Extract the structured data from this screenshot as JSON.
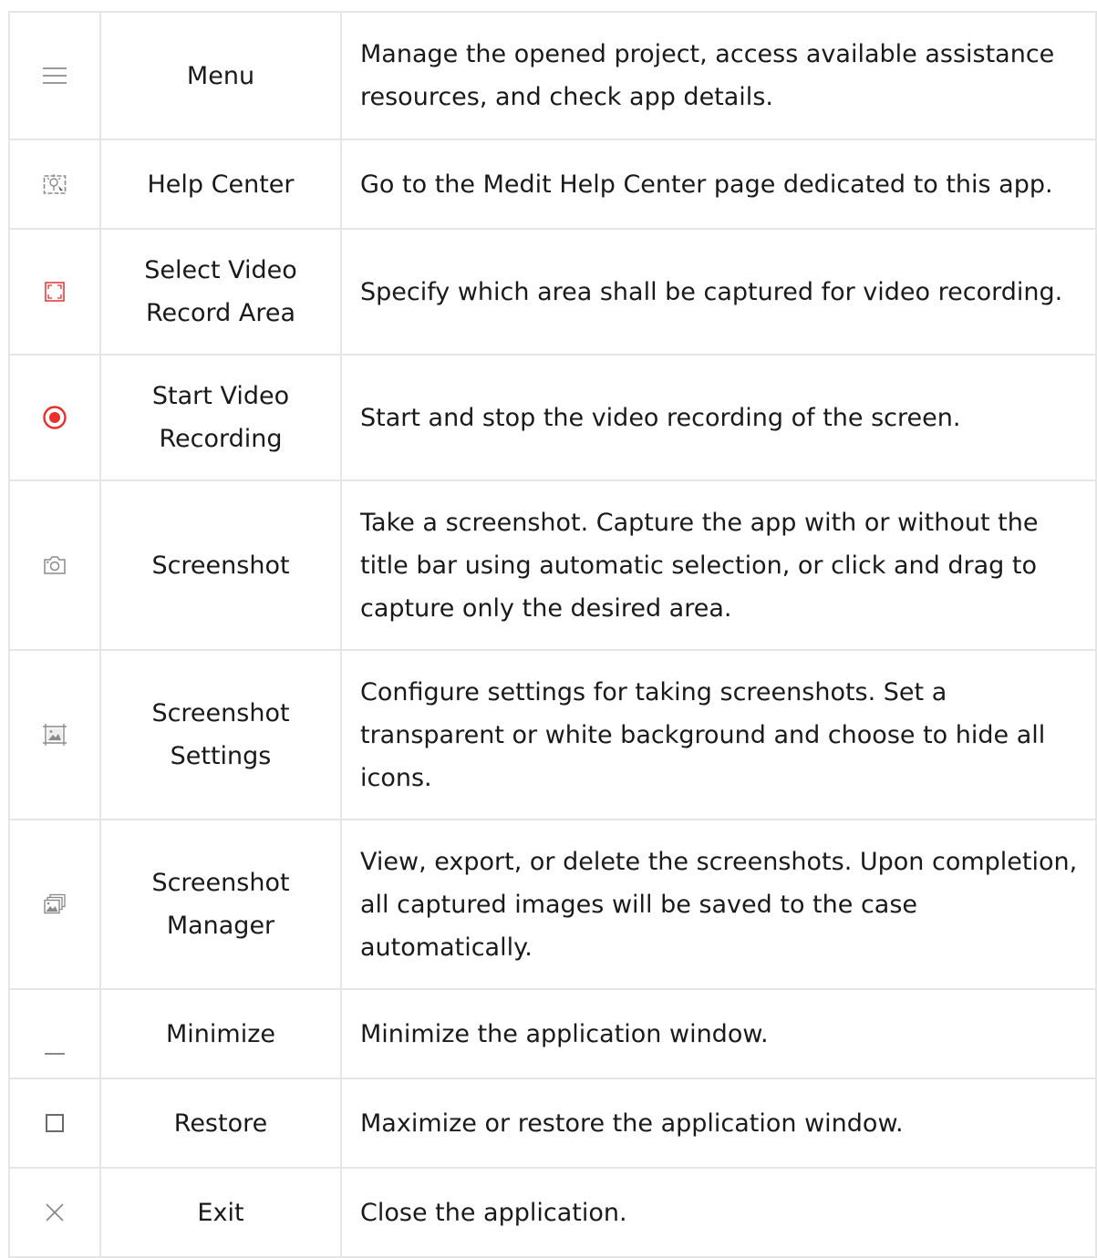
{
  "rows": [
    {
      "icon": "hamburger-menu-icon",
      "name": "Menu",
      "description": "Manage the opened project, access available assistance resources, and check app details."
    },
    {
      "icon": "help-center-icon",
      "name": "Help Center",
      "description": "Go to the Medit Help Center page dedicated to this app."
    },
    {
      "icon": "select-area-icon",
      "name": "Select Video Record Area",
      "description": "Specify which area shall be captured for video recording."
    },
    {
      "icon": "record-icon",
      "name": "Start Video Recording",
      "description": "Start and stop the video recording of the screen."
    },
    {
      "icon": "camera-icon",
      "name": "Screenshot",
      "description": "Take a screenshot. Capture the app with or without the title bar using automatic selection, or click and drag to capture only the desired area."
    },
    {
      "icon": "screenshot-settings-icon",
      "name": "Screenshot Settings",
      "description": "Configure settings for taking screenshots. Set a transparent or white background and choose to hide all icons."
    },
    {
      "icon": "screenshot-manager-icon",
      "name": "Screenshot Manager",
      "description": "View, export, or delete the screenshots. Upon completion, all captured images will be saved to the case automatically."
    },
    {
      "icon": "minimize-icon",
      "name": "Minimize",
      "description": "Minimize the application window."
    },
    {
      "icon": "restore-icon",
      "name": "Restore",
      "description": "Maximize or restore the application window."
    },
    {
      "icon": "close-icon",
      "name": "Exit",
      "description": "Close the application."
    }
  ],
  "colors": {
    "record_red": "#e8312f",
    "icon_gray": "#8a8a8a",
    "border": "#e6e6e6"
  }
}
